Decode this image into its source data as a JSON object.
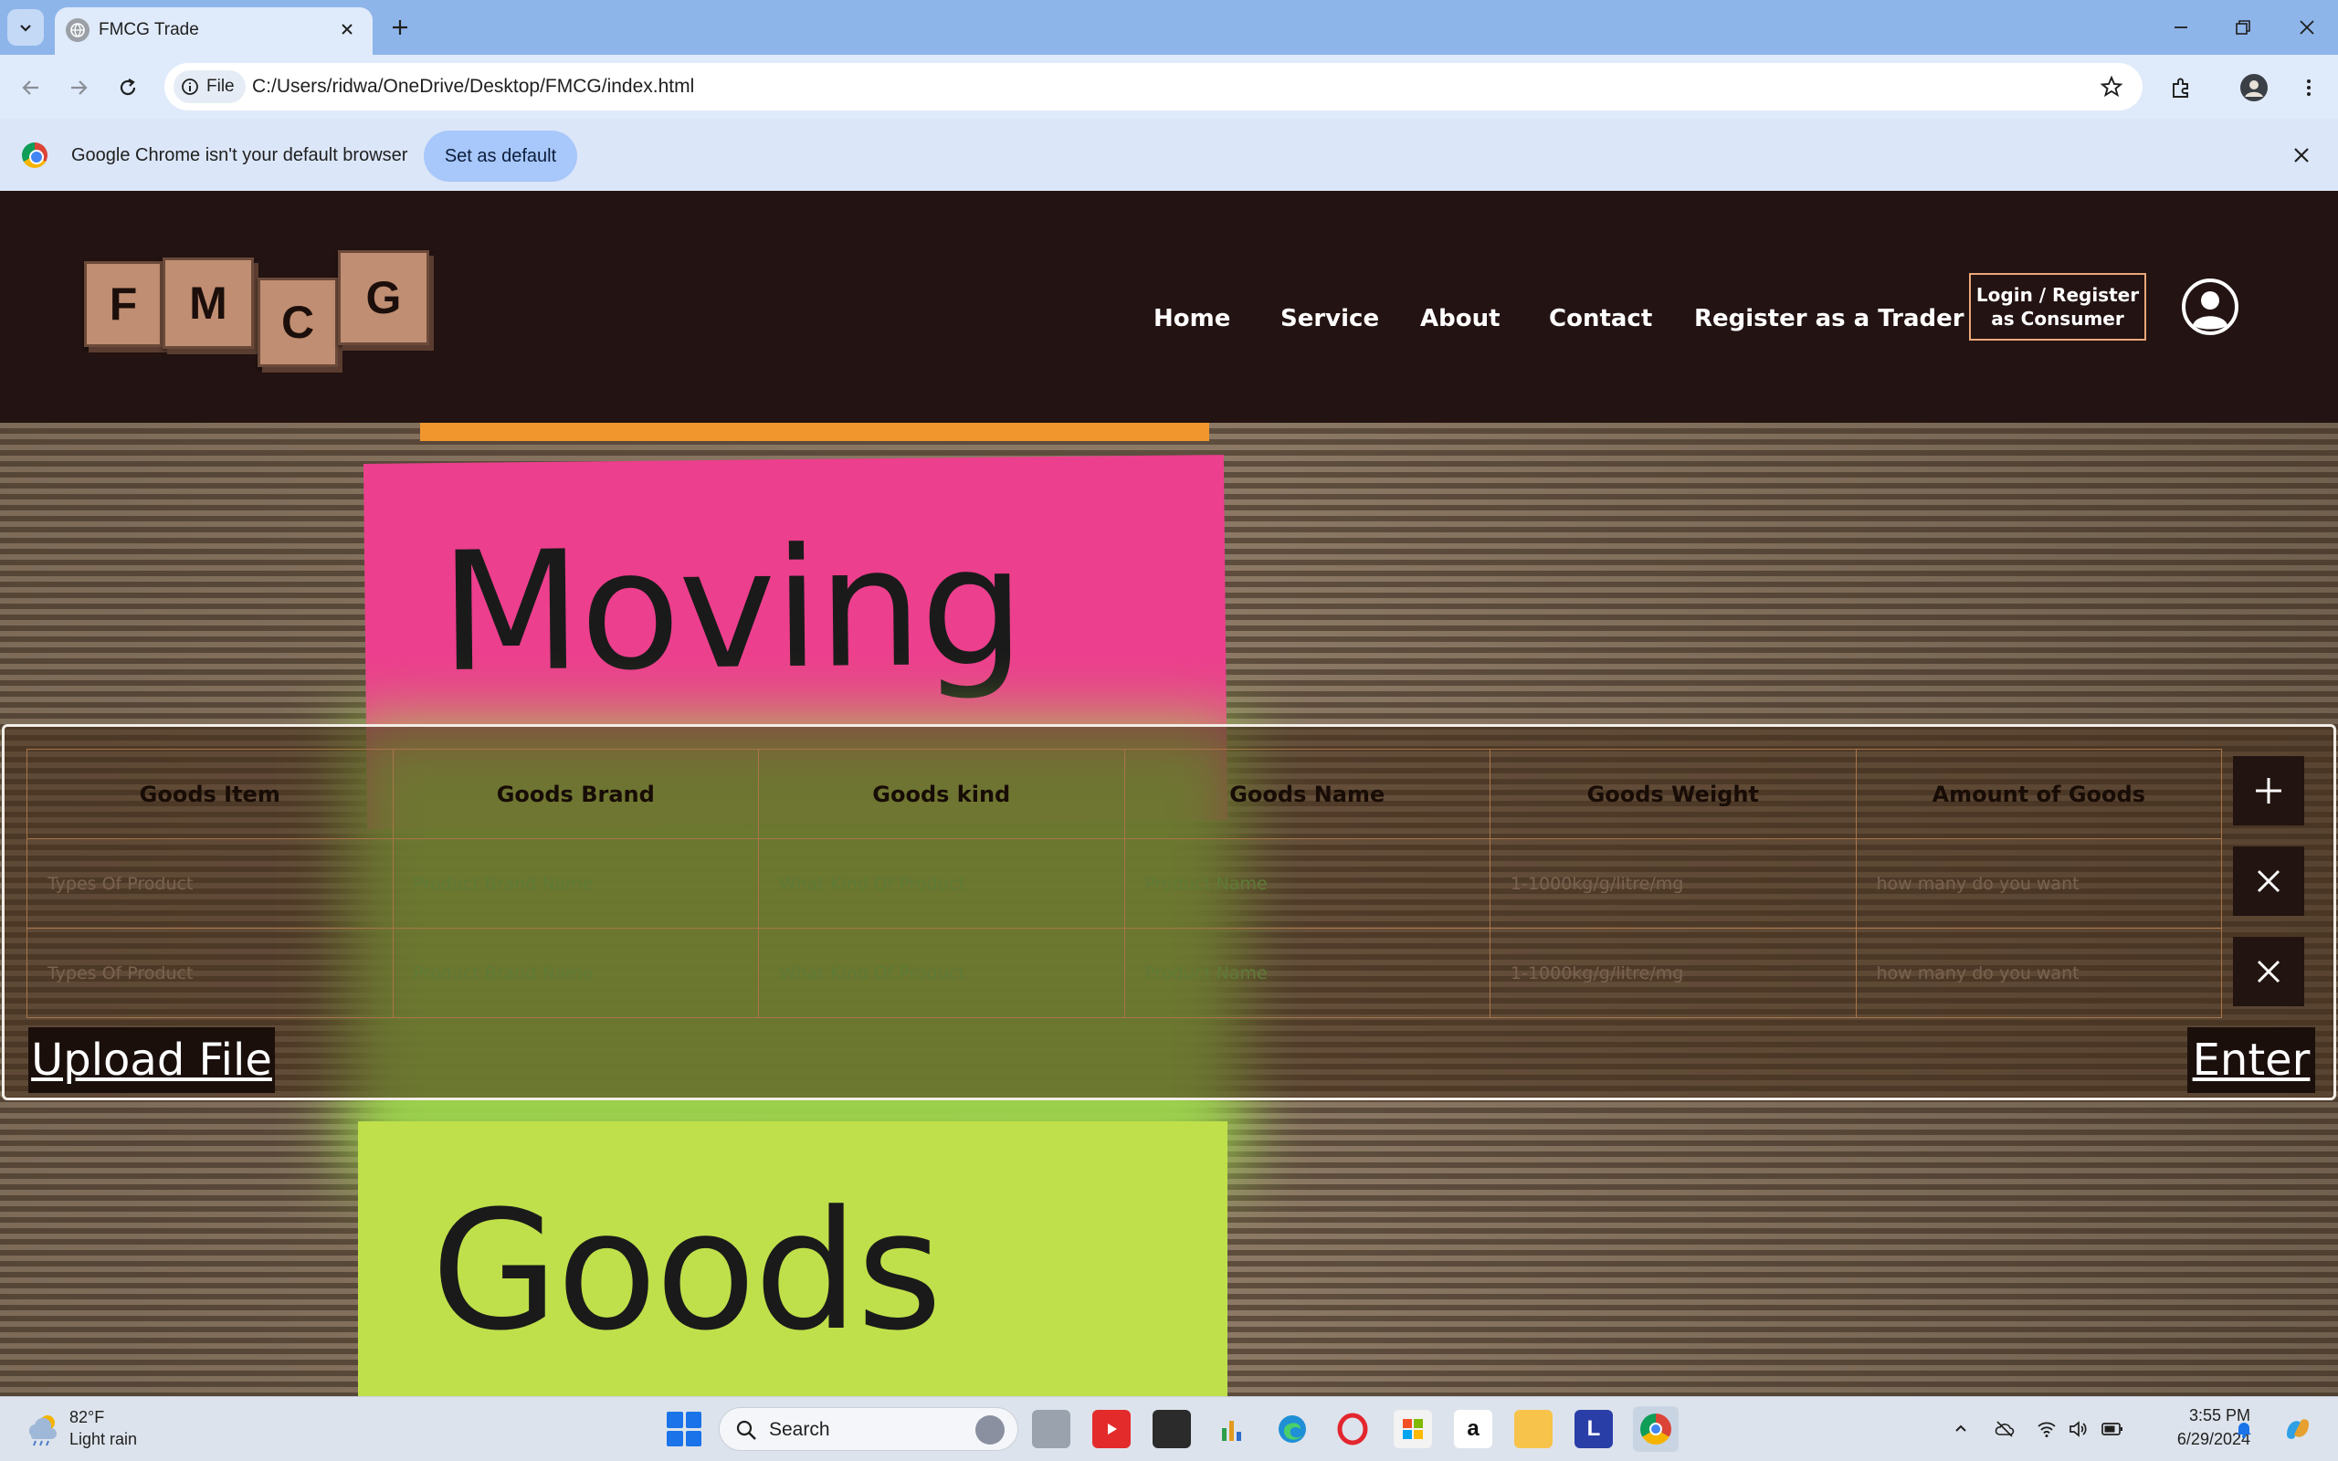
{
  "browser": {
    "tab_title": "FMCG Trade",
    "file_chip": "File",
    "url": "C:/Users/ridwa/OneDrive/Desktop/FMCG/index.html",
    "infobar_text": "Google Chrome isn't your default browser",
    "infobar_button": "Set as default"
  },
  "site": {
    "logo_letters": [
      "F",
      "M",
      "C",
      "G"
    ],
    "nav": [
      "Home",
      "Service",
      "About",
      "Contact",
      "Register as a Trader"
    ],
    "login_label": "Login / Register as Consumer",
    "hero_words": [
      "Moving",
      "Goods"
    ]
  },
  "form": {
    "headers": [
      "Goods Item",
      "Goods Brand",
      "Goods kind",
      "Goods Name",
      "Goods Weight",
      "Amount of Goods"
    ],
    "placeholders": [
      "Types Of Product",
      "Product Brand Name",
      "What Kind Of Product",
      "Product Name",
      "1-1000kg/g/litre/mg",
      "how many do you want"
    ],
    "upload_label": "Upload File",
    "enter_label": "Enter"
  },
  "taskbar": {
    "temp": "82°F",
    "weather": "Light rain",
    "search_label": "Search",
    "time": "3:55 PM",
    "date": "6/29/2024"
  },
  "colors": {
    "header_bg": "#231312",
    "accent_border": "#e9a77a",
    "logo_tile": "#c08e72",
    "pink_note": "#ec3f8d",
    "green_note": "#bfe04a"
  }
}
